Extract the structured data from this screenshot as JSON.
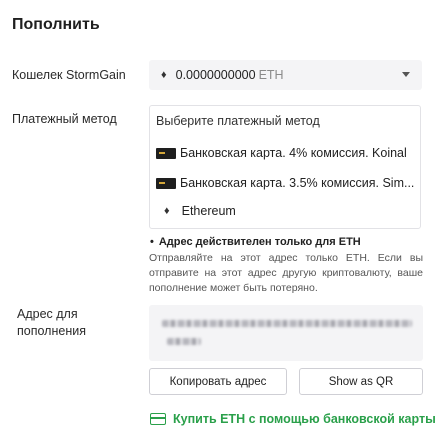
{
  "page": {
    "title": "Пополнить"
  },
  "wallet": {
    "label": "Кошелек StormGain",
    "coin_icon": "♦",
    "amount": "0.0000000000",
    "currency": "ETH"
  },
  "payment": {
    "label": "Платежный метод",
    "placeholder": "Выберите платежный метод",
    "options": [
      {
        "icon": "bank-card-icon",
        "label": "Банковская карта. 4% комиссия. Koinal"
      },
      {
        "icon": "bank-card-icon",
        "label": "Банковская карта. 3.5% комиссия. Sim..."
      },
      {
        "icon": "ethereum-icon",
        "glyph": "♦",
        "label": "Ethereum"
      }
    ]
  },
  "notice": {
    "bullet": "•",
    "title": "Адрес действителен только для ETH",
    "text": "Отправляйте на этот адрес только ETH. Если вы отправите на этот адрес другую криптовалюту, ваше пополнение может быть потеряно."
  },
  "address": {
    "label": "Адрес для пополнения"
  },
  "buttons": {
    "copy": "Копировать адрес",
    "qr": "Show as QR"
  },
  "buy": {
    "label": "Купить ETH с помощью банковской карты"
  },
  "colors": {
    "accent_green": "#2aa04a",
    "field_bg": "#f4f4f6",
    "border": "#cfcfd5"
  }
}
